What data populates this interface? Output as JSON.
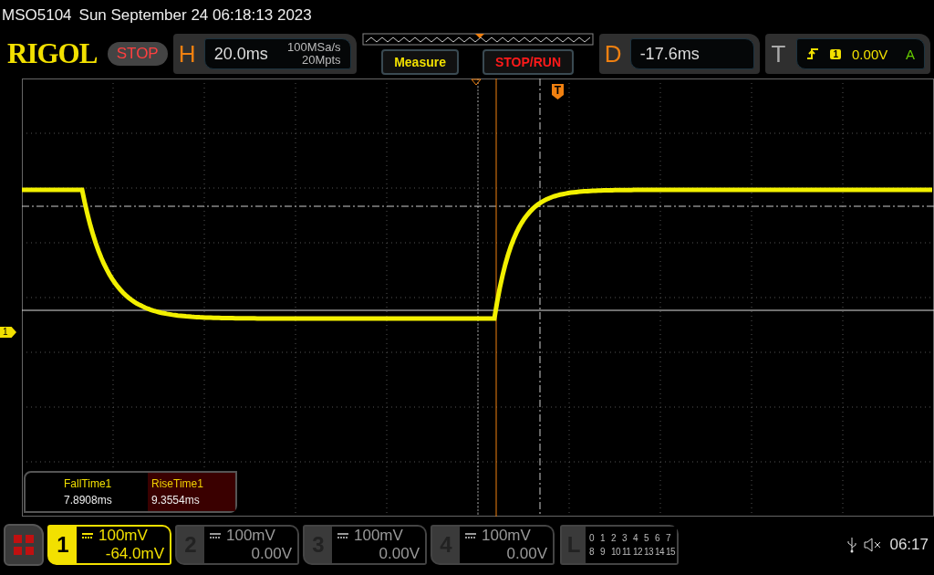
{
  "status_line": {
    "model": "MSO5104",
    "datetime": "Sun September 24 06:18:13 2023"
  },
  "logo": "RIGOL",
  "run_state": {
    "label": "STOP"
  },
  "horizontal": {
    "key": "H",
    "timebase": "20.0ms",
    "sample_rate": "100MSa/s",
    "memory_depth": "20Mpts"
  },
  "buttons": [
    {
      "label": "Measure",
      "kind": "menu"
    },
    {
      "label": "STOP/RUN",
      "kind": "run"
    }
  ],
  "delay": {
    "key": "D",
    "value": "-17.6ms"
  },
  "trigger": {
    "key": "T",
    "source": "1",
    "level": "0.00V",
    "mode": "A"
  },
  "trigger_marker": "T",
  "channel_marker": "1",
  "measurements": [
    {
      "label": "FallTime1",
      "value": "7.8908ms",
      "selected": false
    },
    {
      "label": "RiseTime1",
      "value": "9.3554ms",
      "selected": true
    }
  ],
  "channels": [
    {
      "number": "1",
      "scale": "100mV",
      "offset": "-64.0mV",
      "selected": true
    },
    {
      "number": "2",
      "scale": "100mV",
      "offset": "0.00V",
      "selected": false
    },
    {
      "number": "3",
      "scale": "100mV",
      "offset": "0.00V",
      "selected": false
    },
    {
      "number": "4",
      "scale": "100mV",
      "offset": "0.00V",
      "selected": false
    }
  ],
  "logic": {
    "key": "L",
    "rows": [
      [
        "0",
        "1",
        "2",
        "3",
        "4",
        "5",
        "6",
        "7"
      ],
      [
        "8",
        "9",
        "10",
        "11",
        "12",
        "13",
        "14",
        "15"
      ]
    ]
  },
  "clock": "06:17"
}
